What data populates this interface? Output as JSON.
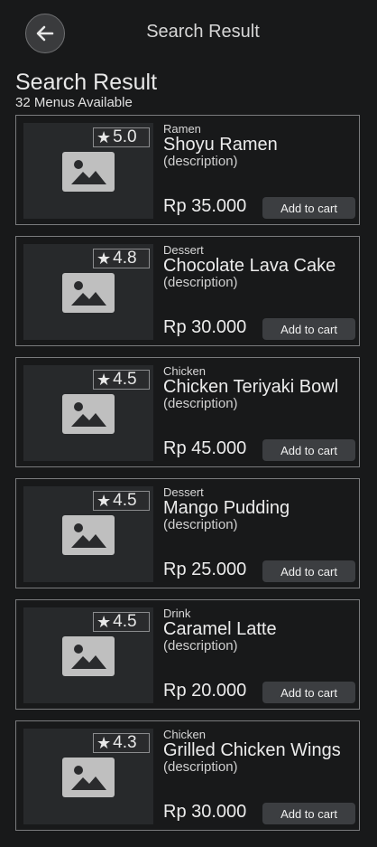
{
  "appbar": {
    "title": "Search Result",
    "back_icon": "arrow-left-icon"
  },
  "header": {
    "title": "Search Result",
    "subtitle": "32 Menus Available"
  },
  "colors": {
    "background": "#18191a",
    "card_border": "#7a7b7d",
    "button": "#3c3e41"
  },
  "items": [
    {
      "rating": "5.0",
      "category": "Ramen",
      "name": "Shoyu Ramen",
      "description": "(description)",
      "price": "Rp 35.000",
      "button": "Add to cart"
    },
    {
      "rating": "4.8",
      "category": "Dessert",
      "name": "Chocolate Lava Cake",
      "description": "(description)",
      "price": "Rp 30.000",
      "button": "Add to cart"
    },
    {
      "rating": "4.5",
      "category": "Chicken",
      "name": "Chicken Teriyaki Bowl",
      "description": "(description)",
      "price": "Rp 45.000",
      "button": "Add to cart"
    },
    {
      "rating": "4.5",
      "category": "Dessert",
      "name": "Mango Pudding",
      "description": "(description)",
      "price": "Rp 25.000",
      "button": "Add to cart"
    },
    {
      "rating": "4.5",
      "category": "Drink",
      "name": "Caramel Latte",
      "description": "(description)",
      "price": "Rp 20.000",
      "button": "Add to cart"
    },
    {
      "rating": "4.3",
      "category": "Chicken",
      "name": "Grilled Chicken Wings",
      "description": "(description)",
      "price": "Rp 30.000",
      "button": "Add to cart"
    }
  ]
}
